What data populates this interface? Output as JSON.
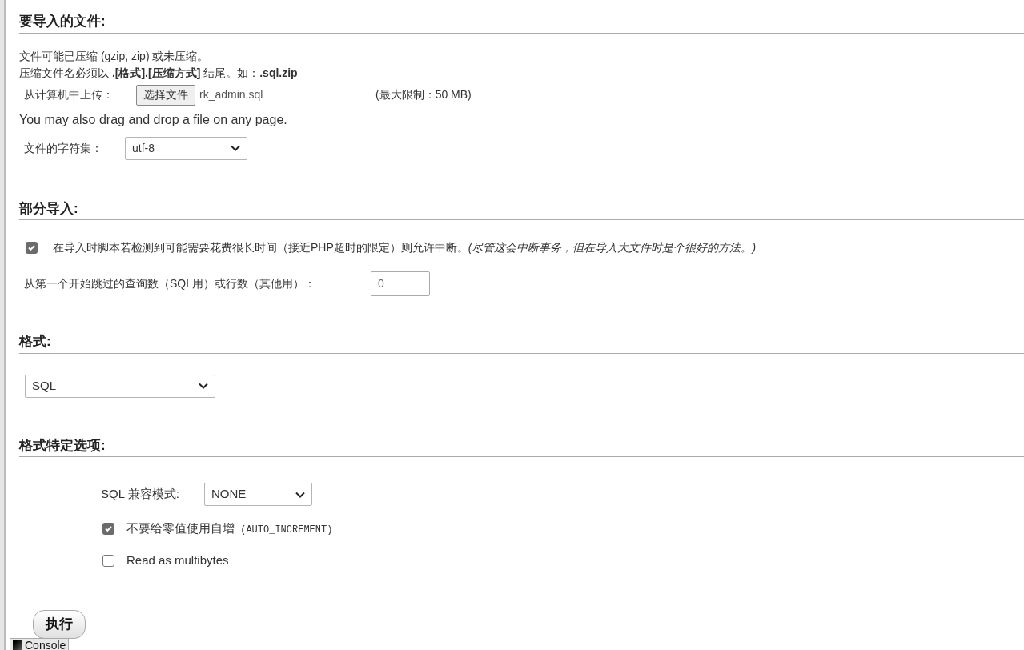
{
  "file_section": {
    "heading": "要导入的文件:",
    "notes": [
      "文件可能已压缩 (gzip, zip) 或未压缩。",
      "压缩文件名必须以 **.[格式].[压缩方式]** 结尾。如：**.sql.zip**"
    ],
    "upload_label": "从计算机中上传：",
    "choose_button": "选择文件",
    "file_name": "rk_admin.sql",
    "max_size": "(最大限制：50 MB)",
    "drag_note": "You may also drag and drop a file on any page.",
    "charset_label": "文件的字符集：",
    "charset_value": "utf-8"
  },
  "partial_section": {
    "heading": "部分导入:",
    "allow_interrupt": {
      "checked": true,
      "label": "在导入时脚本若检测到可能需要花费很长时间（接近PHP超时的限定）则允许中断。*(尽管这会中断事务，但在导入大文件时是个很好的方法。)*"
    },
    "skip_label": "从第一个开始跳过的查询数（SQL用）或行数（其他用）：",
    "skip_value": "0"
  },
  "format_section": {
    "heading": "格式:",
    "format_value": "SQL"
  },
  "options_section": {
    "heading": "格式特定选项:",
    "compat_label": "SQL 兼容模式:",
    "compat_value": "NONE",
    "options": [
      {
        "label": "不要给零值使用自增",
        "code": "(AUTO_INCREMENT)",
        "checked": true
      },
      {
        "label": "Read as multibytes",
        "checked": false
      }
    ]
  },
  "go_button": "执行",
  "console_tab": "Console"
}
